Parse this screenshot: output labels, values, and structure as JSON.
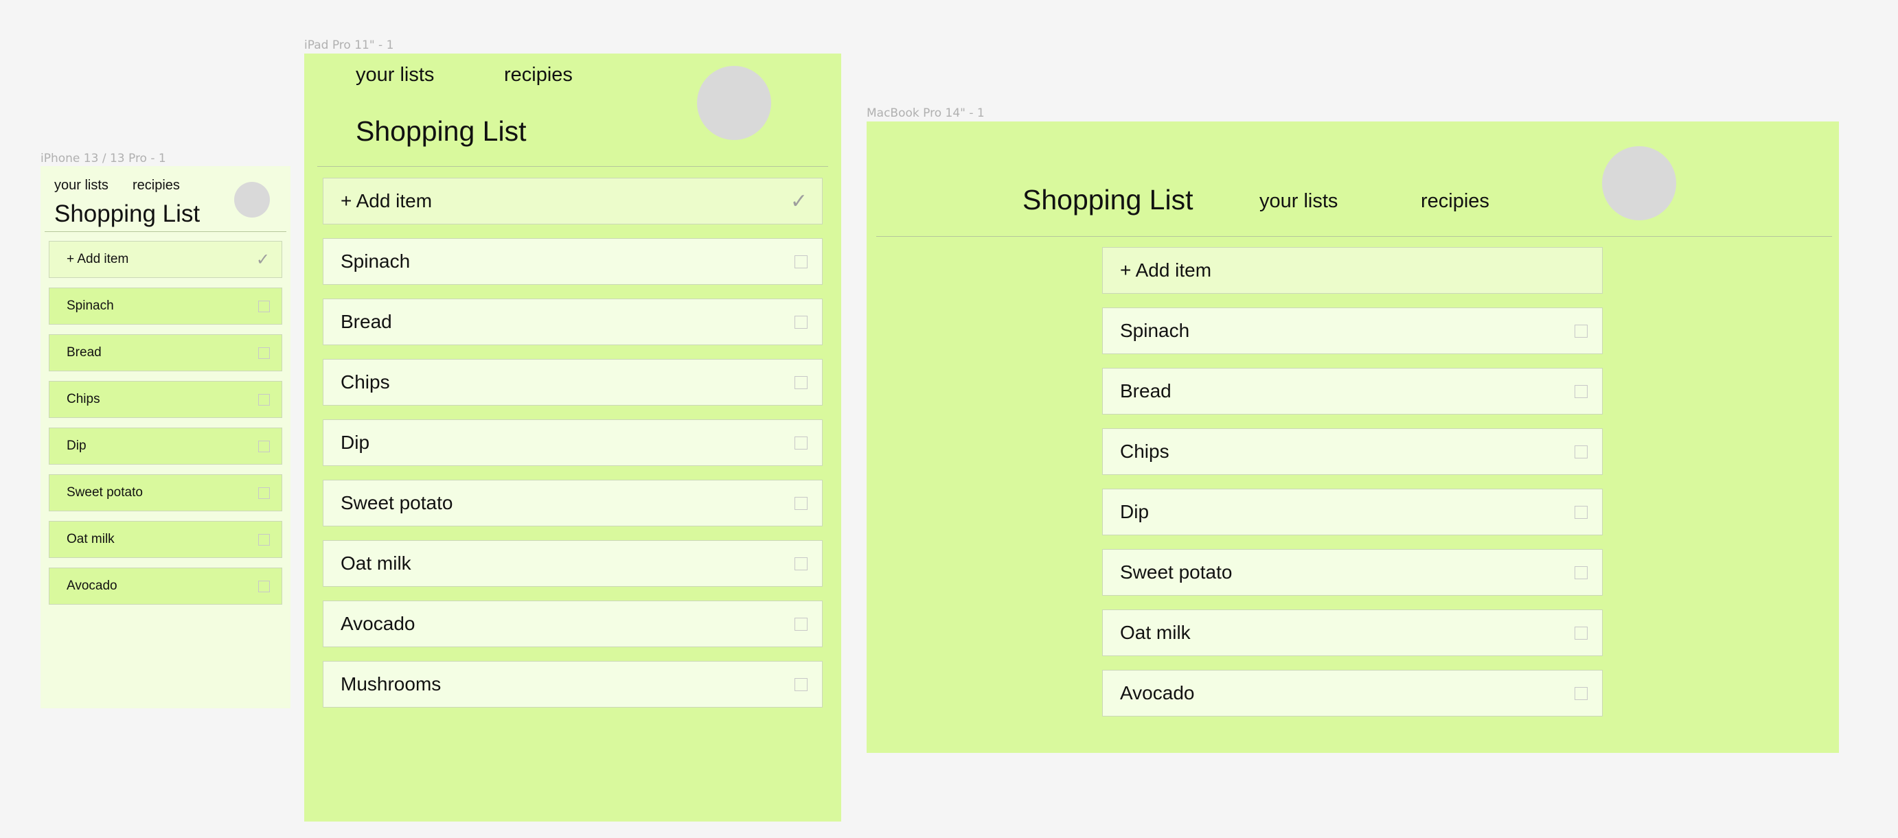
{
  "frames": {
    "phone": {
      "label": "iPhone 13 / 13 Pro - 1",
      "nav": {
        "your_lists": "your lists",
        "recipies": "recipies"
      },
      "title": "Shopping List",
      "add_item": "+ Add item",
      "add_icon": "✓",
      "items": [
        "Spinach",
        "Bread",
        "Chips",
        "Dip",
        "Sweet potato",
        "Oat milk",
        "Avocado"
      ]
    },
    "ipad": {
      "label": "iPad Pro 11\" - 1",
      "nav": {
        "your_lists": "your lists",
        "recipies": "recipies"
      },
      "title": "Shopping List",
      "add_item": "+ Add item",
      "add_icon": "✓",
      "items": [
        "Spinach",
        "Bread",
        "Chips",
        "Dip",
        "Sweet potato",
        "Oat milk",
        "Avocado",
        "Mushrooms"
      ]
    },
    "mac": {
      "label": "MacBook Pro 14\" - 1",
      "nav": {
        "your_lists": "your lists",
        "recipies": "recipies"
      },
      "title": "Shopping List",
      "add_item": "+ Add item",
      "items": [
        "Spinach",
        "Bread",
        "Chips",
        "Dip",
        "Sweet potato",
        "Oat milk",
        "Avocado"
      ]
    }
  },
  "colors": {
    "canvas": "#f5f5f5",
    "frame_green": "#d9f99d",
    "frame_pale": "#f3fde0",
    "row_light": "#f4fee4",
    "add_row": "#ecfccb",
    "avatar": "#d9d9d9"
  },
  "icons": {
    "checkbox": "checkbox-icon",
    "confirm": "checkmark-icon"
  }
}
